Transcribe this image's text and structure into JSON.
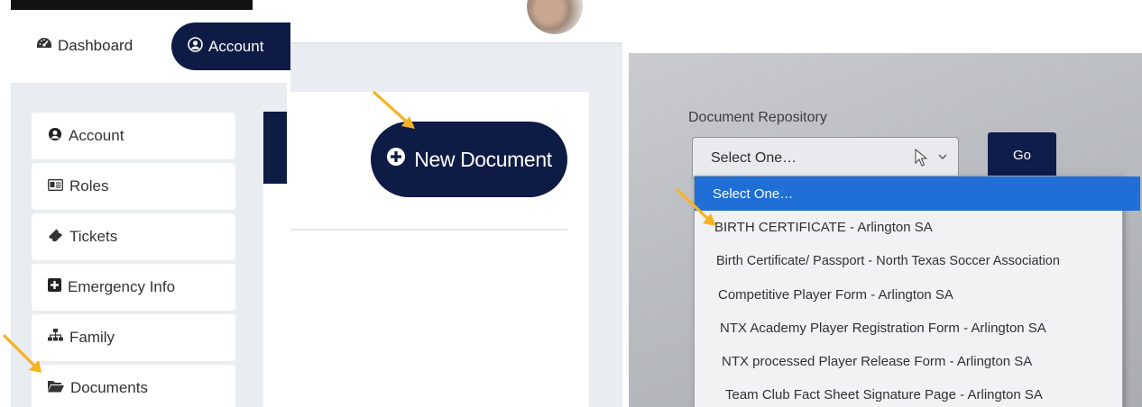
{
  "panel1": {
    "top_nav": {
      "dashboard_label": "Dashboard",
      "dashboard_icon": "tachometer-icon",
      "account_label": "Account",
      "account_icon": "user-circle-icon"
    },
    "sidebar": {
      "items": [
        {
          "label": "Account",
          "icon": "user-circle-icon"
        },
        {
          "label": "Roles",
          "icon": "id-card-icon"
        },
        {
          "label": "Tickets",
          "icon": "ticket-icon"
        },
        {
          "label": "Emergency Info",
          "icon": "plus-square-icon"
        },
        {
          "label": "Family",
          "icon": "sitemap-icon"
        },
        {
          "label": "Documents",
          "icon": "folder-open-icon"
        }
      ]
    }
  },
  "panel2": {
    "new_document_label": "New Document",
    "new_document_icon": "plus-circle-icon"
  },
  "panel3": {
    "repository_label": "Document Repository",
    "select_value": "Select One…",
    "go_label": "Go",
    "options": [
      "Select One…",
      "BIRTH CERTIFICATE - Arlington SA",
      "Birth Certificate/ Passport - North Texas Soccer Association",
      "Competitive Player Form - Arlington SA",
      "NTX Academy Player Registration Form - Arlington SA",
      "NTX processed Player Release Form - Arlington SA",
      "Team Club Fact Sheet Signature Page - Arlington SA"
    ]
  },
  "colors": {
    "navy": "#0d1b45",
    "sidebar_bg": "#e9ecf1",
    "selected_option": "#1f6fd6",
    "arrow": "#f5b323"
  }
}
